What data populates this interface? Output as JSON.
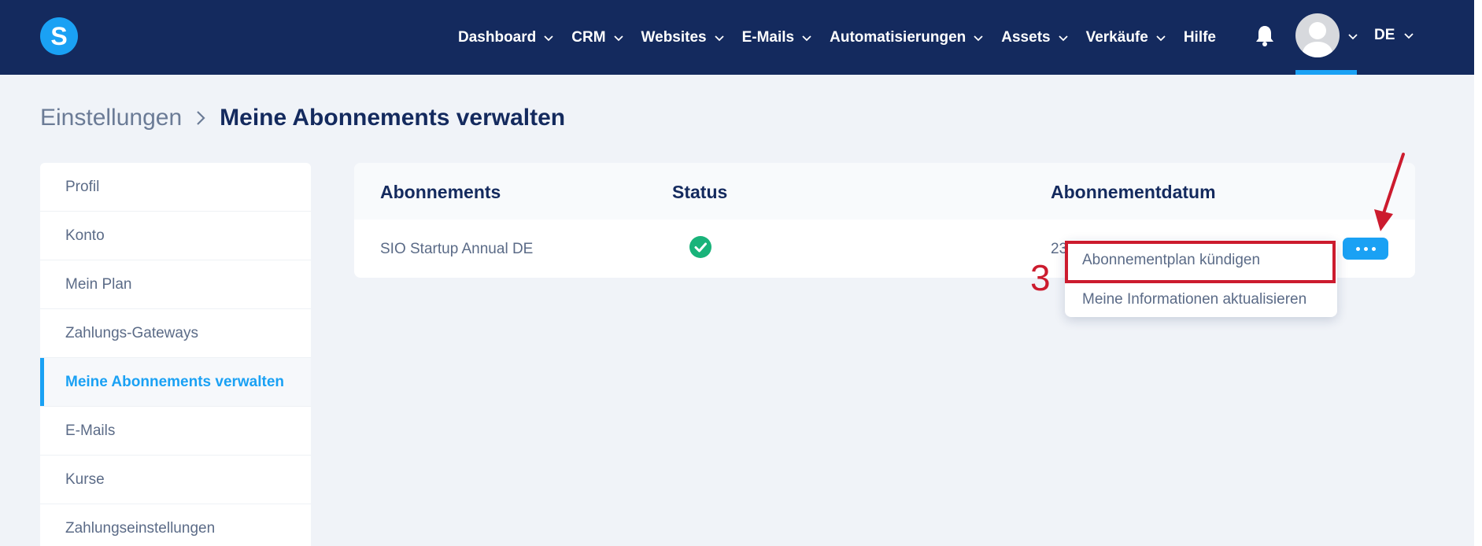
{
  "nav": {
    "items": [
      {
        "label": "Dashboard",
        "has_menu": true
      },
      {
        "label": "CRM",
        "has_menu": true
      },
      {
        "label": "Websites",
        "has_menu": true
      },
      {
        "label": "E-Mails",
        "has_menu": true
      },
      {
        "label": "Automatisierungen",
        "has_menu": true
      },
      {
        "label": "Assets",
        "has_menu": true
      },
      {
        "label": "Verkäufe",
        "has_menu": true
      },
      {
        "label": "Hilfe",
        "has_menu": false
      }
    ],
    "lang": "DE"
  },
  "logo": {
    "letter": "S"
  },
  "breadcrumb": {
    "parent": "Einstellungen",
    "current": "Meine Abonnements verwalten"
  },
  "sidebar": {
    "items": [
      {
        "label": "Profil"
      },
      {
        "label": "Konto"
      },
      {
        "label": "Mein Plan"
      },
      {
        "label": "Zahlungs-Gateways"
      },
      {
        "label": "Meine Abonnements verwalten",
        "active": true
      },
      {
        "label": "E-Mails"
      },
      {
        "label": "Kurse"
      },
      {
        "label": "Zahlungseinstellungen"
      }
    ]
  },
  "table": {
    "headers": {
      "subscriptions": "Abonnements",
      "status": "Status",
      "date": "Abonnementdatum"
    },
    "rows": [
      {
        "name": "SIO Startup Annual DE",
        "status": "active",
        "date_partial": "23"
      }
    ]
  },
  "dropdown": {
    "items": [
      {
        "label": "Abonnementplan kündigen"
      },
      {
        "label": "Meine Informationen aktualisieren"
      }
    ]
  },
  "annotation": {
    "step": "3"
  },
  "colors": {
    "nav_bg": "#142a5e",
    "accent": "#1aa1f4",
    "success": "#19b37a",
    "annotation": "#cc1b2e"
  }
}
